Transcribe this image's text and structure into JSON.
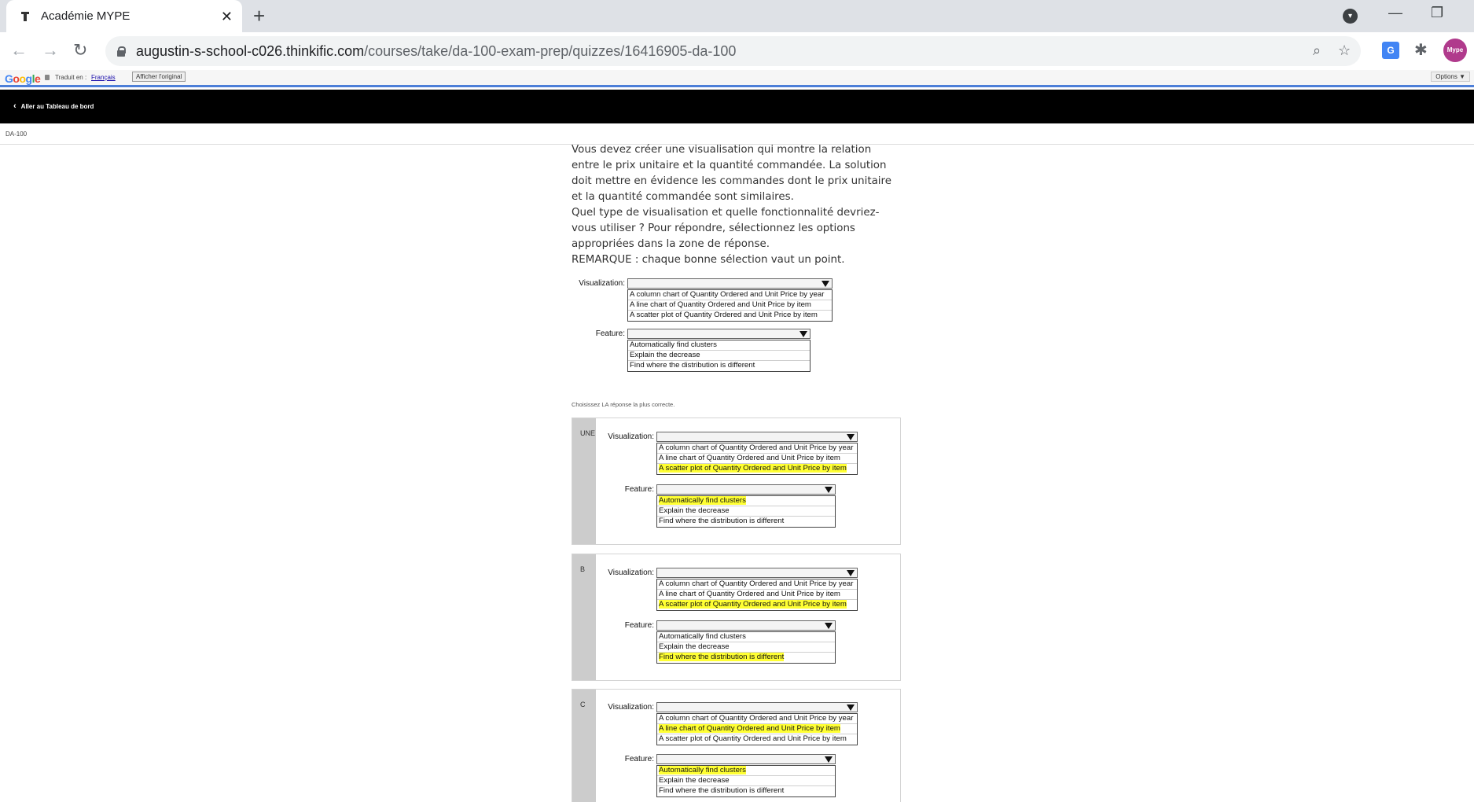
{
  "browser": {
    "tab_title": "Académie MYPE",
    "url_host": "augustin-s-school-c026.thinkific.com",
    "url_path": "/courses/take/da-100-exam-prep/quizzes/16416905-da-100",
    "avatar_text": "Mype"
  },
  "translate_bar": {
    "logo": "Google",
    "translated_to": "Traduit en :",
    "language": "Français",
    "show_original": "Afficher l'original",
    "options": "Options ▼"
  },
  "nav": {
    "back_label": "Aller au Tableau de bord",
    "course_label": "DA-100"
  },
  "question": {
    "paragraphs": [
      "Vous devez créer une visualisation qui montre la relation entre le prix unitaire et la quantité commandée. La solution doit mettre en évidence les commandes dont le prix unitaire et la quantité commandée sont similaires.",
      "Quel type de visualisation et quelle fonctionnalité devriez-vous utiliser ? Pour répondre, sélectionnez les options appropriées dans la zone de réponse.",
      "REMARQUE : chaque bonne sélection vaut un point."
    ],
    "visualization_label": "Visualization:",
    "feature_label": "Feature:",
    "visualization_options": [
      "A column chart of Quantity Ordered and Unit Price by year",
      "A line chart of Quantity Ordered and Unit Price by item",
      "A scatter plot of Quantity Ordered and Unit Price by item"
    ],
    "feature_options": [
      "Automatically find clusters",
      "Explain the decrease",
      "Find where the distribution is different"
    ]
  },
  "instruction": "Choisissez LA réponse la plus correcte.",
  "answers": [
    {
      "letter": "UNE",
      "selected_visualization": 2,
      "selected_feature": 0
    },
    {
      "letter": "B",
      "selected_visualization": 2,
      "selected_feature": 2
    },
    {
      "letter": "C",
      "selected_visualization": 1,
      "selected_feature": 0
    }
  ],
  "colors": {
    "highlight": "#ffff33",
    "answer_bar": "#cccccc",
    "top_nav": "#000000"
  }
}
